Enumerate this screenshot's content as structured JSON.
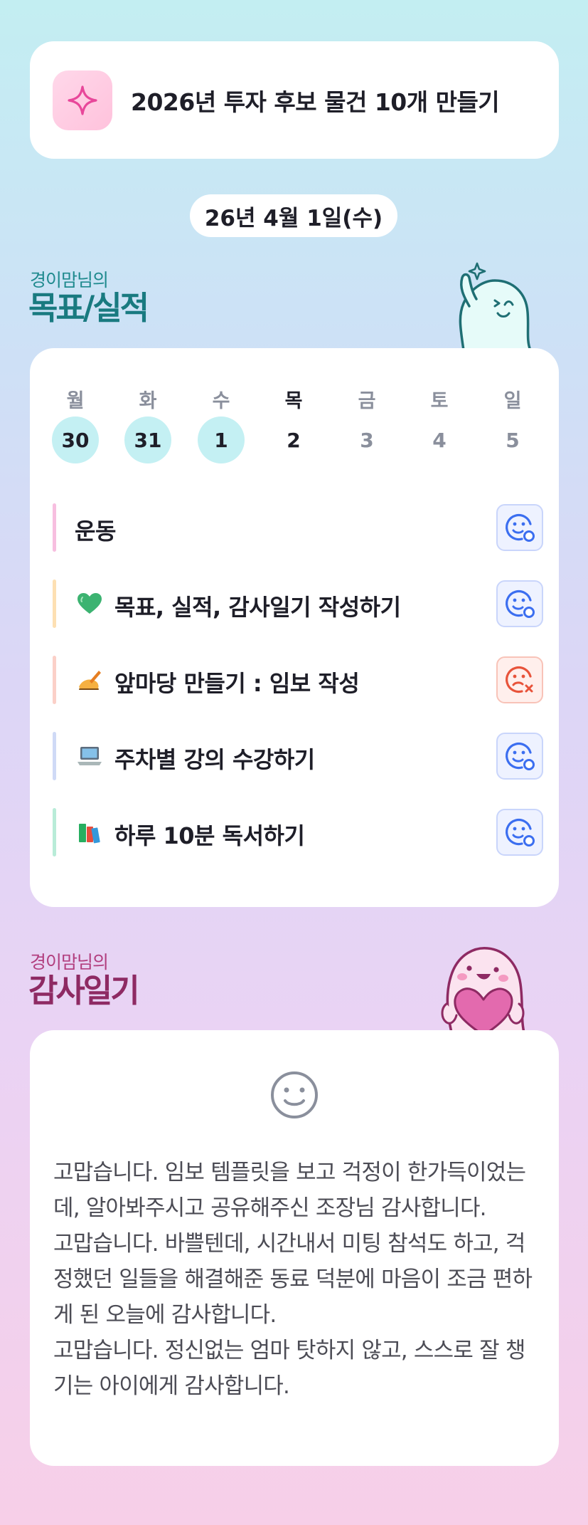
{
  "goal_card": {
    "icon": "sparkle-icon",
    "text": "2026년 투자 후보 물건 10개 만들기"
  },
  "date_pill": "26년 4월 1일(수)",
  "goals_section": {
    "subtitle": "경이맘님의",
    "title": "목표/실적"
  },
  "week": {
    "days": [
      {
        "name": "월",
        "num": "30",
        "state": "done"
      },
      {
        "name": "화",
        "num": "31",
        "state": "done"
      },
      {
        "name": "수",
        "num": "1",
        "state": "done"
      },
      {
        "name": "목",
        "num": "2",
        "state": "today"
      },
      {
        "name": "금",
        "num": "3",
        "state": "future"
      },
      {
        "name": "토",
        "num": "4",
        "state": "future"
      },
      {
        "name": "일",
        "num": "5",
        "state": "future"
      }
    ]
  },
  "tasks": [
    {
      "label": "운동",
      "emoji": "",
      "bar_color": "#f7bfe0",
      "status": "done"
    },
    {
      "label": "목표, 실적, 감사일기 작성하기",
      "emoji": "green-heart-icon",
      "bar_color": "#fde0b3",
      "status": "done"
    },
    {
      "label": "앞마당 만들기 : 임보 작성",
      "emoji": "writing-hand-icon",
      "bar_color": "#fbd0c8",
      "status": "failed"
    },
    {
      "label": "주차별 강의 수강하기",
      "emoji": "laptop-icon",
      "bar_color": "#cfdaf6",
      "status": "done"
    },
    {
      "label": "하루 10분 독서하기",
      "emoji": "books-icon",
      "bar_color": "#b9ecd8",
      "status": "done"
    }
  ],
  "gratitude_section": {
    "subtitle": "경이맘님의",
    "title": "감사일기"
  },
  "gratitude_entries": [
    "고맙습니다. 임보 템플릿을 보고 걱정이 한가득이었는데, 알아봐주시고 공유해주신 조장님 감사합니다.",
    "고맙습니다. 바쁠텐데, 시간내서 미팅 참석도 하고, 걱정했던 일들을 해결해준 동료 덕분에 마음이 조금 편하게 된 오늘에 감사합니다.",
    "고맙습니다. 정신없는 엄마 탓하지 않고, 스스로 잘 챙기는 아이에게 감사합니다."
  ],
  "colors": {
    "accent_teal": "#197a80",
    "accent_magenta": "#8e2a63",
    "done_circle": "#c4f0f3",
    "status_ok": "#3b6ef0",
    "status_fail": "#e8533a"
  }
}
